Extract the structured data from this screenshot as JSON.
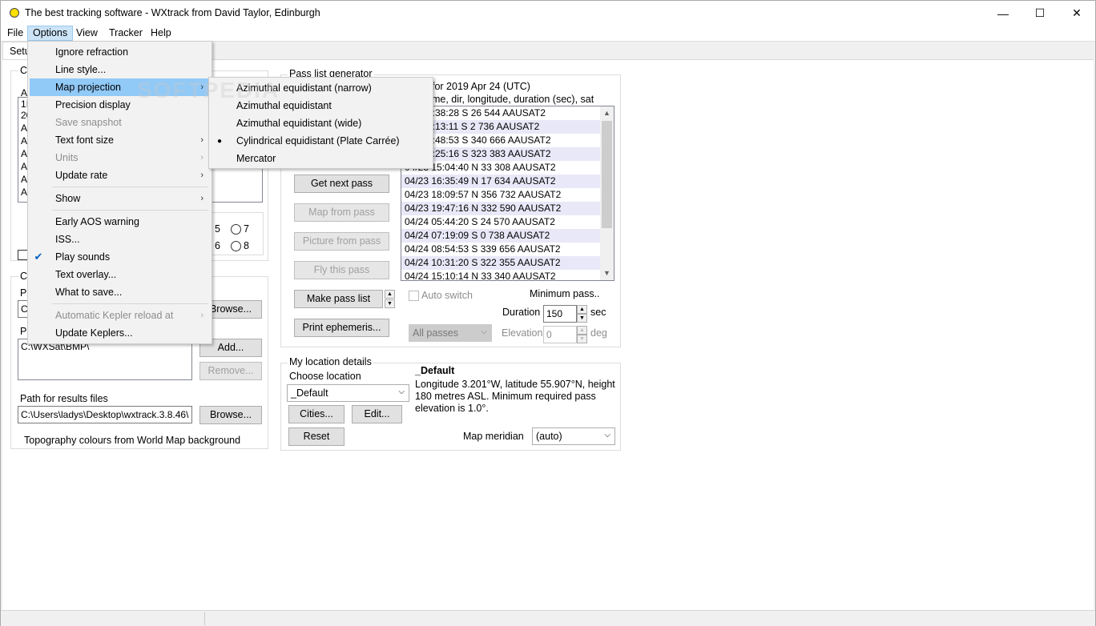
{
  "window": {
    "title": "The best tracking software - WXtrack from David Taylor, Edinburgh",
    "min_glyph": "—",
    "max_glyph": "☐",
    "close_glyph": "✕"
  },
  "menubar": [
    "File",
    "Options",
    "View",
    "Tracker",
    "Help"
  ],
  "tabs": {
    "setup": "Setu"
  },
  "left_panel": {
    "group1_label": "C",
    "list_partial": [
      "A",
      "1I",
      "20",
      "A",
      "A",
      "A",
      "A",
      "A",
      "A",
      "A"
    ],
    "radio_labels": [
      "5",
      "7",
      "6",
      "8"
    ],
    "group2_label": "C",
    "path_labels": [
      "Pa",
      "Pa"
    ],
    "path_value": "C:\\WXSat\\BMP\\",
    "browse_label": "Browse...",
    "add_label": "Add...",
    "remove_label": "Remove...",
    "results_label": "Path for results files",
    "results_value": "C:\\Users\\ladys\\Desktop\\wxtrack.3.8.46\\",
    "results_browse_label": "Browse...",
    "topography_text": "Topography colours from World Map background"
  },
  "pass_generator": {
    "group_label": "Pass list generator",
    "header_line1": "for 2019 Apr 24  (UTC)",
    "header_line2": "me, dir, longitude, duration (sec), sat",
    "passes": [
      "5:38:28 S 26 544 AAUSAT2",
      "7:13:11 S 2 736 AAUSAT2",
      "8:48:53 S 340 666 AAUSAT2",
      "0:25:16 S 323 383 AAUSAT2",
      "04/23 15:04:40 N 33 308 AAUSAT2",
      "04/23 16:35:49 N 17 634 AAUSAT2",
      "04/23 18:09:57 N 356 732 AAUSAT2",
      "04/23 19:47:16 N 332 590 AAUSAT2",
      "04/24 05:44:20 S 24 570 AAUSAT2",
      "04/24 07:19:09 S 0 738 AAUSAT2",
      "04/24 08:54:53 S 339 656 AAUSAT2",
      "04/24 10:31:20 S 322 355 AAUSAT2",
      "04/24 15:10:14 N 33 340 AAUSAT2"
    ],
    "get_next_pass": "Get next pass",
    "map_from_pass": "Map from pass",
    "picture_from_pass": "Picture from pass",
    "fly_this_pass": "Fly this pass",
    "make_pass_list": "Make pass list",
    "print_ephemeris": "Print ephemeris...",
    "auto_switch": "Auto switch",
    "minimum_pass": "Minimum pass..",
    "duration_label": "Duration",
    "duration_value": "150",
    "duration_unit": "sec",
    "elevation_label": "Elevation",
    "elevation_value": "0",
    "elevation_unit": "deg",
    "all_passes": "All passes"
  },
  "location": {
    "group_label": "My location details",
    "choose_label": "Choose location",
    "selected": "_Default",
    "name": "_Default",
    "details": "Longitude 3.201°W,  latitude 55.907°N,  height 180 metres ASL.  Minimum required pass elevation is 1.0°.",
    "cities": "Cities...",
    "edit": "Edit...",
    "reset": "Reset",
    "meridian_label": "Map meridian",
    "meridian_value": "(auto)"
  },
  "options_menu": [
    {
      "label": "Ignore refraction"
    },
    {
      "label": "Line style..."
    },
    {
      "label": "Map projection",
      "submenu": true,
      "highlight": true
    },
    {
      "label": "Precision display"
    },
    {
      "label": "Save snapshot",
      "disabled": true
    },
    {
      "label": "Text font size",
      "submenu": true
    },
    {
      "label": "Units",
      "disabled": true,
      "submenu": true
    },
    {
      "label": "Update rate",
      "submenu": true
    },
    {
      "label": "Show",
      "submenu": true
    },
    {
      "label": "Early AOS warning"
    },
    {
      "label": "ISS..."
    },
    {
      "label": "Play sounds",
      "checked": true
    },
    {
      "label": "Text overlay..."
    },
    {
      "label": "What to save..."
    },
    {
      "label": "Automatic Kepler reload at",
      "disabled": true,
      "submenu": true
    },
    {
      "label": "Update Keplers..."
    }
  ],
  "projection_menu": [
    {
      "label": "Azimuthal equidistant (narrow)"
    },
    {
      "label": "Azimuthal equidistant"
    },
    {
      "label": "Azimuthal equidistant (wide)"
    },
    {
      "label": "Cylindrical equidistant (Plate Carrée)",
      "selected": true
    },
    {
      "label": "Mercator"
    }
  ],
  "watermark": "SOFTPEDIA",
  "colors": {
    "highlight": "#91c9f7",
    "menu_active": "#cce4f7",
    "list_alt": "#e8e8f8"
  }
}
